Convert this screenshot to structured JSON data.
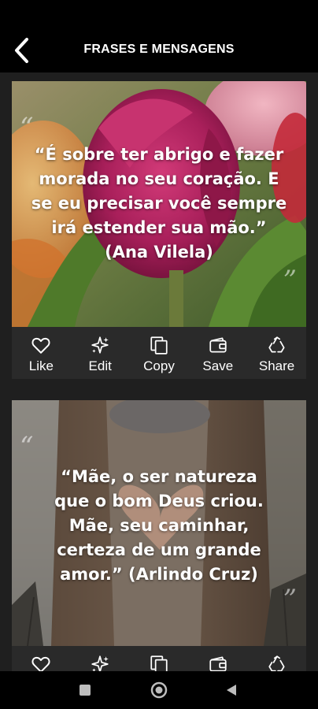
{
  "header": {
    "title": "FRASES E MENSAGENS",
    "back_icon": "back-arrow-icon"
  },
  "cards": [
    {
      "quote": "“É sobre ter abrigo e fazer morada no seu coração. E se eu precisar você sempre irá estender sua mão.” (Ana Vilela)",
      "background": "pink-tulips"
    },
    {
      "quote": "“Mãe, o ser natureza que o bom Deus criou. Mãe, seu caminhar, certeza de um grande amor.” (Arlindo Cruz)",
      "background": "heart-hands"
    }
  ],
  "actions": [
    {
      "label": "Like",
      "icon": "heart-icon"
    },
    {
      "label": "Edit",
      "icon": "sparkle-icon"
    },
    {
      "label": "Copy",
      "icon": "copy-icon"
    },
    {
      "label": "Save",
      "icon": "wallet-icon"
    },
    {
      "label": "Share",
      "icon": "recycle-share-icon"
    }
  ],
  "navbar": {
    "icons": [
      "square-icon",
      "circle-icon",
      "back-triangle-icon"
    ]
  }
}
